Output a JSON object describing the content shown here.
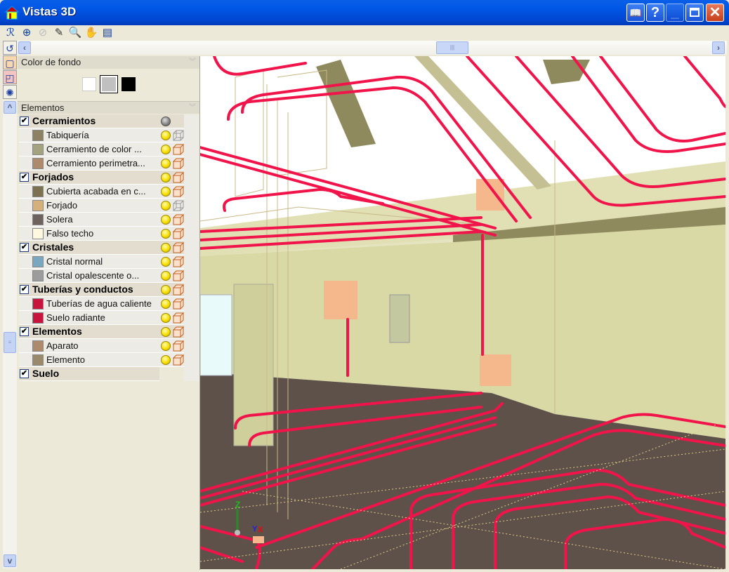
{
  "window": {
    "title": "Vistas 3D",
    "buttons": [
      "book-help",
      "help",
      "minimize",
      "maximize",
      "close"
    ],
    "help_label": "?"
  },
  "toolbar": {
    "icons": [
      "rotate-view",
      "zoom-window",
      "zoom-previous",
      "edit-pencil",
      "zoom-dynamic",
      "pan-hand",
      "export-view"
    ]
  },
  "left_tools": {
    "icons": [
      "undo-rotate",
      "solid-view",
      "orbit-view",
      "render-settings"
    ]
  },
  "panel": {
    "background": {
      "title": "Color de fondo",
      "options": [
        {
          "color": "#ffffff"
        },
        {
          "color": "#c0c0c0",
          "selected": true
        },
        {
          "color": "#000000"
        }
      ]
    },
    "elements": {
      "title": "Elementos",
      "groups": [
        {
          "label": "Cerramientos",
          "checked": true,
          "light": "off",
          "items": [
            {
              "label": "Tabiquería",
              "color": "#8c8162",
              "mode": "wire"
            },
            {
              "label": "Cerramiento de color ...",
              "color": "#a3a37f",
              "mode": "solid"
            },
            {
              "label": "Cerramiento perimetra...",
              "color": "#ad8a6c",
              "mode": "solid"
            }
          ]
        },
        {
          "label": "Forjados",
          "checked": true,
          "light": "on",
          "items": [
            {
              "label": "Cubierta acabada en c...",
              "color": "#7c7150",
              "mode": "solid"
            },
            {
              "label": "Forjado",
              "color": "#d6b07c",
              "mode": "wire"
            },
            {
              "label": "Solera",
              "color": "#6e625e",
              "mode": "solid"
            },
            {
              "label": "Falso techo",
              "color": "#fff8e1",
              "mode": "solid"
            }
          ]
        },
        {
          "label": "Cristales",
          "checked": true,
          "light": "on",
          "items": [
            {
              "label": "Cristal normal",
              "color": "#7ba6bf",
              "mode": "solid"
            },
            {
              "label": "Cristal opalescente o...",
              "color": "#9c9c9c",
              "mode": "solid"
            }
          ]
        },
        {
          "label": "Tuberías y conductos",
          "checked": true,
          "light": "on",
          "items": [
            {
              "label": "Tuberías de agua caliente",
              "color": "#c8143c",
              "mode": "solid"
            },
            {
              "label": "Suelo radiante",
              "color": "#c8143c",
              "mode": "solid"
            }
          ]
        },
        {
          "label": "Elementos",
          "checked": true,
          "light": "on",
          "items": [
            {
              "label": "Aparato",
              "color": "#ad8a6c",
              "mode": "solid"
            },
            {
              "label": "Elemento",
              "color": "#9a8a6c",
              "mode": "solid"
            }
          ]
        },
        {
          "label": "Suelo",
          "checked": true,
          "items": []
        }
      ]
    }
  },
  "axes": {
    "z": "Z",
    "y": "Y",
    "x": "X"
  },
  "colors": {
    "pipe": "#f0144a",
    "floor": "#5e514a",
    "wall": "#d9d9a6",
    "ceiling": "#e4e4bc",
    "slab": "#8f8a5e"
  }
}
